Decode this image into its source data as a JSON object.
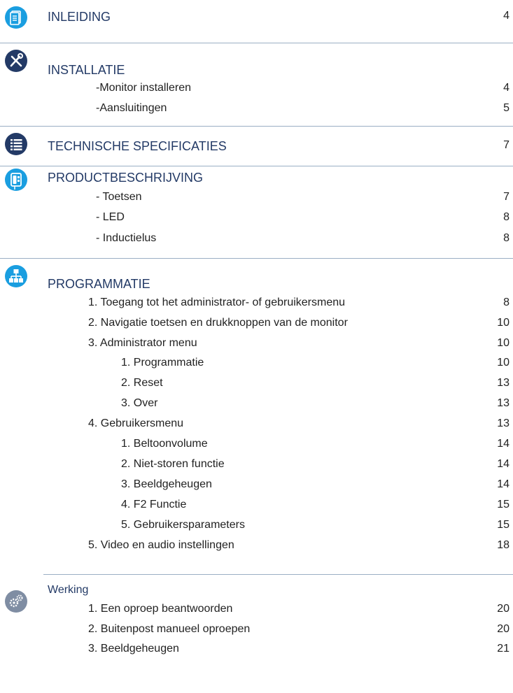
{
  "sections": [
    {
      "icon": "document-icon",
      "title": "INLEIDING",
      "page": "4"
    },
    {
      "icon": "tools-icon",
      "title": "INSTALLATIE",
      "items": [
        {
          "label": "-Monitor installeren",
          "page": "4"
        },
        {
          "label": "-Aansluitingen",
          "page": "5"
        }
      ]
    },
    {
      "icon": "list-icon",
      "title": "TECHNISCHE SPECIFICATIES",
      "page": "7"
    },
    {
      "icon": "intercom-icon",
      "title": "PRODUCTBESCHRIJVING",
      "items": [
        {
          "label": "- Toetsen",
          "page": "7"
        },
        {
          "label": "- LED",
          "page": "8"
        },
        {
          "label": "- Inductielus",
          "page": "8"
        }
      ]
    },
    {
      "icon": "sitemap-icon",
      "title": "PROGRAMMATIE",
      "items": [
        {
          "label": "1.  Toegang tot het administrator- of gebruikersmenu",
          "page": "8"
        },
        {
          "label": "2.  Navigatie toetsen en drukknoppen van de monitor",
          "page": "10"
        },
        {
          "label": "3.  Administrator menu",
          "page": "10"
        },
        {
          "label": "1. Programmatie",
          "page": "10"
        },
        {
          "label": "2. Reset",
          "page": "13"
        },
        {
          "label": "3. Over",
          "page": "13"
        },
        {
          "label": "4.  Gebruikersmenu",
          "page": "13"
        },
        {
          "label": "1. Beltoonvolume",
          "page": "14"
        },
        {
          "label": "2. Niet-storen functie",
          "page": "14"
        },
        {
          "label": "3. Beeldgeheugen",
          "page": "14"
        },
        {
          "label": "4. F2 Functie",
          "page": "15"
        },
        {
          "label": "5. Gebruikersparameters",
          "page": "15"
        },
        {
          "label": "5.  Video en audio instellingen",
          "page": "18"
        }
      ]
    },
    {
      "icon": "gears-icon",
      "title": "Werking",
      "items": [
        {
          "label": "1. Een oproep beantwoorden",
          "page": "20"
        },
        {
          "label": "2.  Buitenpost manueel oproepen",
          "page": "20"
        },
        {
          "label": "3.  Beeldgeheugen",
          "page": "21"
        }
      ]
    }
  ]
}
